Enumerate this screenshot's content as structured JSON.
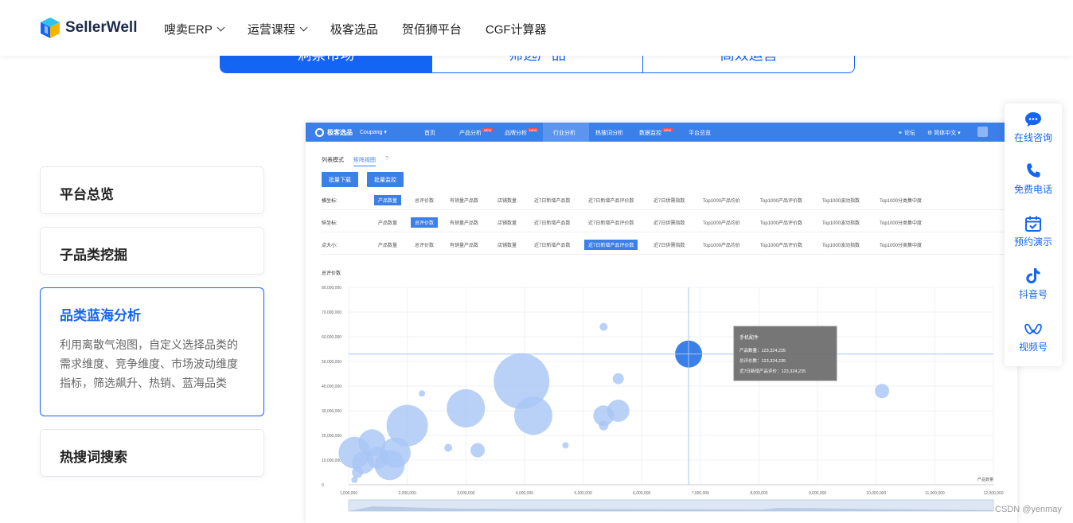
{
  "header": {
    "brand": "SellerWell",
    "nav": [
      {
        "label": "嗖卖ERP",
        "dropdown": true
      },
      {
        "label": "运营课程",
        "dropdown": true
      },
      {
        "label": "极客选品",
        "dropdown": false
      },
      {
        "label": "贺佰狮平台",
        "dropdown": false
      },
      {
        "label": "CGF计算器",
        "dropdown": false
      }
    ]
  },
  "tabs": [
    {
      "label": "洞察市场",
      "active": true
    },
    {
      "label": "筛选产品",
      "active": false
    },
    {
      "label": "高效运营",
      "active": false
    }
  ],
  "features": [
    {
      "title": "平台总览",
      "active": false,
      "desc": ""
    },
    {
      "title": "子品类挖掘",
      "active": false,
      "desc": ""
    },
    {
      "title": "品类蓝海分析",
      "active": true,
      "desc": "利用离散气泡图，自定义选择品类的需求维度、竞争维度、市场波动维度指标，筛选飙升、热销、蓝海品类"
    },
    {
      "title": "热搜词搜索",
      "active": false,
      "desc": ""
    }
  ],
  "app": {
    "brand": "极客选品",
    "market": "Coupang",
    "menu": [
      "首页",
      "产品分析",
      "品牌分析",
      "行业分析",
      "热搜词分析",
      "数据监控",
      "平台总览"
    ],
    "new_badge": "NEW",
    "right_items": [
      "论坛",
      "简体中文"
    ],
    "view_modes": [
      "列表模式",
      "矩阵视图"
    ],
    "buttons": [
      "批量下载",
      "批量监控"
    ],
    "filters": [
      {
        "label": "横坐标:",
        "selected": "产品数量"
      },
      {
        "label": "纵坐标:",
        "selected": "总评价数"
      },
      {
        "label": "点大小:",
        "selected": "近7日新增产品评价数"
      }
    ],
    "filter_options": [
      "产品数量",
      "总评价数",
      "有销量产品数",
      "店铺数量",
      "近7日新增产品数",
      "近7日新增产品评价数",
      "近7日供需指数",
      "Top1000产品均价",
      "Top1000产品评价数",
      "Top1000波动指数",
      "Top1000分类集中度"
    ],
    "tooltip": {
      "title": "手机配件",
      "lines": [
        "产品数量：123,324,235",
        "总评价数：123,324,235",
        "近7日新增产品评价：123,324,235"
      ]
    }
  },
  "chart_data": {
    "type": "scatter",
    "xlabel": "产品数量",
    "ylabel": "总评价数",
    "xlim": [
      1000000,
      12000000
    ],
    "ylim": [
      0,
      80000000
    ],
    "x_ticks": [
      "1,000,000",
      "2,000,000",
      "3,000,000",
      "4,000,000",
      "5,000,000",
      "6,000,000",
      "7,000,000",
      "8,000,000",
      "9,000,000",
      "10,000,000",
      "11,000,000",
      "12,000,000"
    ],
    "y_ticks": [
      "0",
      "10,000,000",
      "20,000,000",
      "30,000,000",
      "40,000,000",
      "50,000,000",
      "60,000,000",
      "70,000,000",
      "80,000,000"
    ],
    "points": [
      {
        "x": 1100000,
        "y": 2000000,
        "size": 4,
        "highlight": false
      },
      {
        "x": 1150000,
        "y": 5000000,
        "size": 7,
        "highlight": false
      },
      {
        "x": 1100000,
        "y": 13000000,
        "size": 20,
        "highlight": false
      },
      {
        "x": 1250000,
        "y": 9000000,
        "size": 14,
        "highlight": false
      },
      {
        "x": 1400000,
        "y": 17000000,
        "size": 17,
        "highlight": false
      },
      {
        "x": 1500000,
        "y": 11000000,
        "size": 14,
        "highlight": false
      },
      {
        "x": 1700000,
        "y": 8000000,
        "size": 19,
        "highlight": false
      },
      {
        "x": 1800000,
        "y": 13000000,
        "size": 19,
        "highlight": false
      },
      {
        "x": 2000000,
        "y": 24000000,
        "size": 26,
        "highlight": false
      },
      {
        "x": 2250000,
        "y": 37000000,
        "size": 4,
        "highlight": false
      },
      {
        "x": 2700000,
        "y": 15000000,
        "size": 5,
        "highlight": false
      },
      {
        "x": 3000000,
        "y": 31000000,
        "size": 24,
        "highlight": false
      },
      {
        "x": 3200000,
        "y": 14000000,
        "size": 9,
        "highlight": false
      },
      {
        "x": 3950000,
        "y": 42000000,
        "size": 35,
        "highlight": false
      },
      {
        "x": 4150000,
        "y": 28000000,
        "size": 24,
        "highlight": false
      },
      {
        "x": 4700000,
        "y": 16000000,
        "size": 4,
        "highlight": false
      },
      {
        "x": 5600000,
        "y": 43000000,
        "size": 7,
        "highlight": false
      },
      {
        "x": 5350000,
        "y": 64000000,
        "size": 5,
        "highlight": false
      },
      {
        "x": 5350000,
        "y": 24000000,
        "size": 6,
        "highlight": false
      },
      {
        "x": 5350000,
        "y": 28000000,
        "size": 13,
        "highlight": false
      },
      {
        "x": 5600000,
        "y": 30000000,
        "size": 14,
        "highlight": false
      },
      {
        "x": 6800000,
        "y": 53000000,
        "size": 17,
        "highlight": true
      },
      {
        "x": 10100000,
        "y": 38000000,
        "size": 9,
        "highlight": false
      }
    ]
  },
  "sidebar": [
    {
      "label": "在线咨询",
      "icon": "chat-icon"
    },
    {
      "label": "免费电话",
      "icon": "phone-icon"
    },
    {
      "label": "预约演示",
      "icon": "calendar-icon"
    },
    {
      "label": "抖音号",
      "icon": "douyin-icon"
    },
    {
      "label": "视频号",
      "icon": "video-channel-icon"
    }
  ],
  "watermark": "CSDN @yenmay",
  "colors": {
    "brand_blue": "#1565f5",
    "app_blue": "#3b7fe8",
    "bubble": "#a8c6f5",
    "bubble_highlight": "#3b7fe8"
  }
}
